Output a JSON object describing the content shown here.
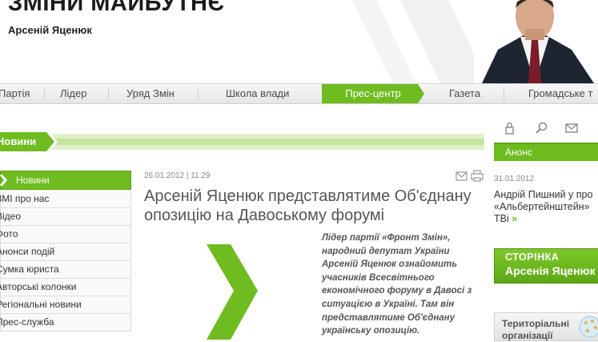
{
  "header": {
    "title": "ЗМІНИ МАЙБУТНЄ",
    "subtitle": "Арсеній Яценюк"
  },
  "nav": {
    "items": [
      {
        "label": "Партія"
      },
      {
        "label": "Лідер"
      },
      {
        "label": "Уряд Змін"
      },
      {
        "label": "Школа влади"
      },
      {
        "label": "Прес-центр",
        "active": true
      },
      {
        "label": "Газета"
      },
      {
        "label": "Громадське т"
      }
    ]
  },
  "news_bar": {
    "label": "Новини"
  },
  "sidebar": {
    "active": "Новини",
    "items": [
      {
        "label": "ЗМІ про нас"
      },
      {
        "label": "Відео"
      },
      {
        "label": "Фото"
      },
      {
        "label": "Анонси подій"
      },
      {
        "label": "Сумка юриста"
      },
      {
        "label": "Авторські колонки"
      },
      {
        "label": "Регіональні новини"
      },
      {
        "label": "Прес-служба"
      }
    ]
  },
  "article": {
    "meta": "26.01.2012 | 11:29",
    "title": "Арсеній Яценюк представлятиме Об'єднану опозицію на Давоському форумі",
    "lead": "Лідер партії «Фронт Змін», народний депутат України Арсеній Яценюк ознайомить учасників Всесвітнього економічного форуму в Давосі з ситуацією в Україні. Там він представлятиме Об'єднану українську опозицію."
  },
  "right": {
    "anons_label": "Анонс",
    "anons_date": "31.01.2012",
    "anons_line1": "Андрій Пишний у про",
    "anons_line2": "«Альбертейнштейн»",
    "anons_line3": "ТВі",
    "anons_more": "»",
    "banner_line1": "СТОРІНКА",
    "banner_line2": "Арсенія Яценюк",
    "org_line1": "Територіальні",
    "org_line2": "організації"
  },
  "colors": {
    "accent_green": "#6ebc1f",
    "dark_green": "#5aa313",
    "text_gray": "#555555"
  },
  "icons": {
    "utility": [
      "lock-icon",
      "search-icon",
      "mail-icon"
    ],
    "article_tools": [
      "email-icon",
      "print-icon"
    ]
  }
}
